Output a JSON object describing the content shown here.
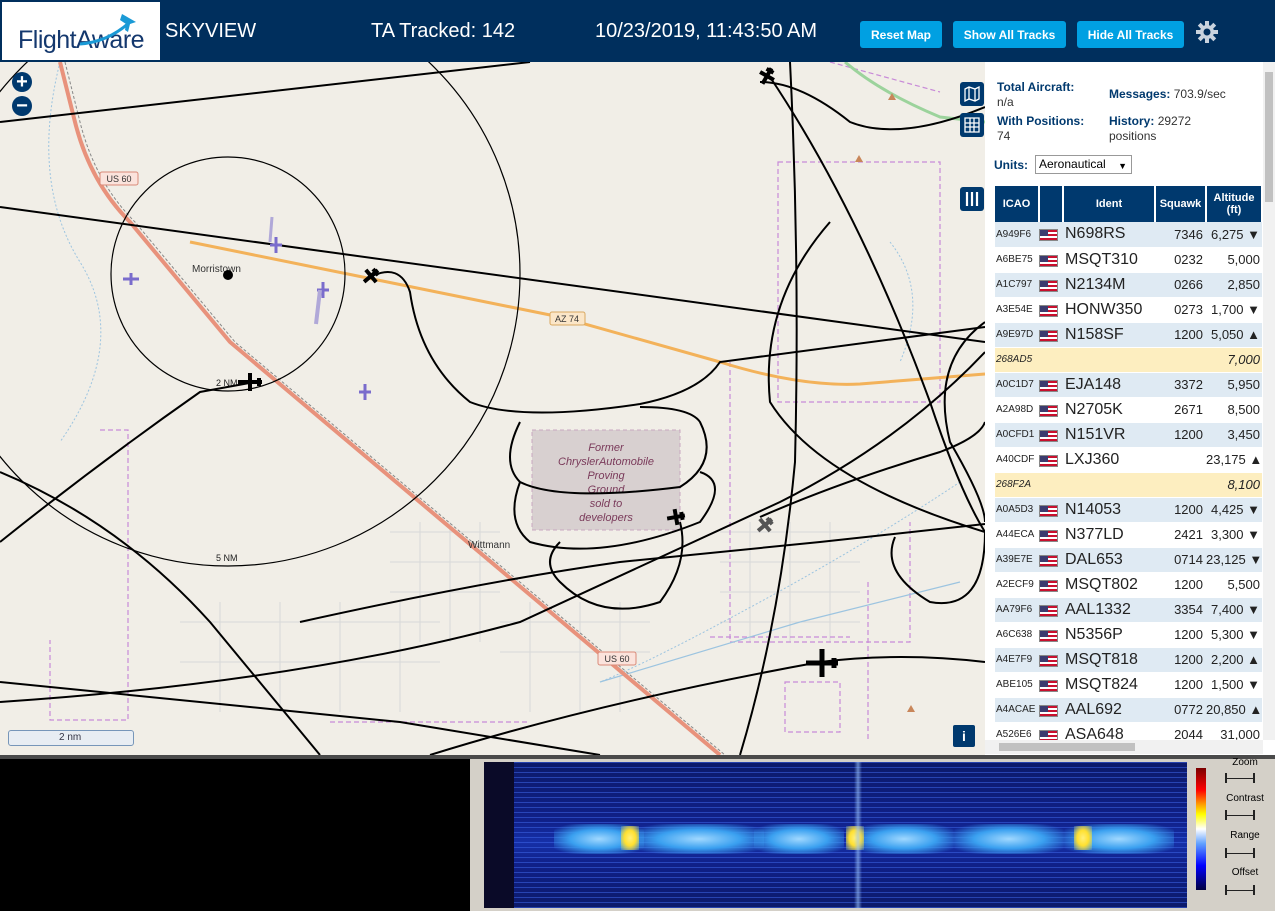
{
  "header": {
    "logo_text": "FlightAware",
    "app_name": "SKYVIEW",
    "tracked_label": "TA Tracked: 142",
    "timestamp": "10/23/2019, 11:43:50 AM",
    "reset_map": "Reset Map",
    "show_all_tracks": "Show All Tracks",
    "hide_all_tracks": "Hide All Tracks"
  },
  "map": {
    "zoom_in": "+",
    "zoom_out": "−",
    "scale_label": "2 nm",
    "info": "i",
    "labels": {
      "us60_a": "US 60",
      "us60_b": "US 60",
      "az74": "AZ 74",
      "morristown": "Morristown",
      "wittmann": "Wittmann",
      "ring_2nm": "2 NM",
      "ring_5nm": "5 NM",
      "former_1": "Former",
      "former_2": "ChryslerAutomobile",
      "former_3": "Proving",
      "former_4": "Ground",
      "former_5": "sold to",
      "former_6": "developers"
    }
  },
  "sidebar": {
    "total_aircraft_label": "Total Aircraft:",
    "total_aircraft_value": "n/a",
    "messages_label": "Messages:",
    "messages_value": "703.9/sec",
    "with_positions_label": "With Positions:",
    "with_positions_value": "74",
    "history_label": "History:",
    "history_value": "29272",
    "history_unit": "positions",
    "units_label": "Units:",
    "units_value": "Aeronautical",
    "columns": [
      "ICAO",
      "",
      "Ident",
      "Squawk",
      "Altitude (ft)"
    ],
    "rows": [
      {
        "icao": "A949F6",
        "ident": "N698RS",
        "squawk": "7346",
        "alt": "6,275 ▼",
        "flag": true,
        "kind": "normal"
      },
      {
        "icao": "A6BE75",
        "ident": "MSQT310",
        "squawk": "0232",
        "alt": "5,000",
        "flag": true,
        "kind": "alt"
      },
      {
        "icao": "A1C797",
        "ident": "N2134M",
        "squawk": "0266",
        "alt": "2,850",
        "flag": true,
        "kind": "normal"
      },
      {
        "icao": "A3E54E",
        "ident": "HONW350",
        "squawk": "0273",
        "alt": "1,700 ▼",
        "flag": true,
        "kind": "alt"
      },
      {
        "icao": "A9E97D",
        "ident": "N158SF",
        "squawk": "1200",
        "alt": "5,050 ▲",
        "flag": true,
        "kind": "normal"
      },
      {
        "icao": "268AD5",
        "ident": "",
        "squawk": "",
        "alt": "7,000",
        "flag": false,
        "kind": "mlat"
      },
      {
        "icao": "A0C1D7",
        "ident": "EJA148",
        "squawk": "3372",
        "alt": "5,950",
        "flag": true,
        "kind": "normal"
      },
      {
        "icao": "A2A98D",
        "ident": "N2705K",
        "squawk": "2671",
        "alt": "8,500",
        "flag": true,
        "kind": "alt"
      },
      {
        "icao": "A0CFD1",
        "ident": "N151VR",
        "squawk": "1200",
        "alt": "3,450",
        "flag": true,
        "kind": "normal"
      },
      {
        "icao": "A40CDF",
        "ident": "LXJ360",
        "squawk": "",
        "alt": "23,175 ▲",
        "flag": true,
        "kind": "alt"
      },
      {
        "icao": "268F2A",
        "ident": "",
        "squawk": "",
        "alt": "8,100",
        "flag": false,
        "kind": "mlat"
      },
      {
        "icao": "A0A5D3",
        "ident": "N14053",
        "squawk": "1200",
        "alt": "4,425 ▼",
        "flag": true,
        "kind": "normal"
      },
      {
        "icao": "A44ECA",
        "ident": "N377LD",
        "squawk": "2421",
        "alt": "3,300 ▼",
        "flag": true,
        "kind": "alt"
      },
      {
        "icao": "A39E7E",
        "ident": "DAL653",
        "squawk": "0714",
        "alt": "23,125 ▼",
        "flag": true,
        "kind": "normal"
      },
      {
        "icao": "A2ECF9",
        "ident": "MSQT802",
        "squawk": "1200",
        "alt": "5,500",
        "flag": true,
        "kind": "alt"
      },
      {
        "icao": "AA79F6",
        "ident": "AAL1332",
        "squawk": "3354",
        "alt": "7,400 ▼",
        "flag": true,
        "kind": "normal"
      },
      {
        "icao": "A6C638",
        "ident": "N5356P",
        "squawk": "1200",
        "alt": "5,300 ▼",
        "flag": true,
        "kind": "alt"
      },
      {
        "icao": "A4E7F9",
        "ident": "MSQT818",
        "squawk": "1200",
        "alt": "2,200 ▲",
        "flag": true,
        "kind": "normal"
      },
      {
        "icao": "ABE105",
        "ident": "MSQT824",
        "squawk": "1200",
        "alt": "1,500 ▼",
        "flag": true,
        "kind": "alt"
      },
      {
        "icao": "A4ACAE",
        "ident": "AAL692",
        "squawk": "0772",
        "alt": "20,850 ▲",
        "flag": true,
        "kind": "normal"
      },
      {
        "icao": "A526E6",
        "ident": "ASA648",
        "squawk": "2044",
        "alt": "31,000",
        "flag": true,
        "kind": "alt"
      }
    ]
  },
  "waterfall": {
    "controls": [
      "Zoom",
      "Contrast",
      "Range",
      "Offset"
    ]
  },
  "icons": {
    "gear": "gear-icon",
    "map_layers": "map-icon",
    "grid": "grid-icon",
    "columns": "columns-icon",
    "aircraft": "plane-icon"
  },
  "colors": {
    "header_bg": "#002f5d",
    "button_bg": "#00a0e2",
    "table_header": "#00396e",
    "row_light": "#dfeaf3",
    "row_mlat": "#fdeec0",
    "highway": "#e8927c",
    "track": "#000000"
  }
}
